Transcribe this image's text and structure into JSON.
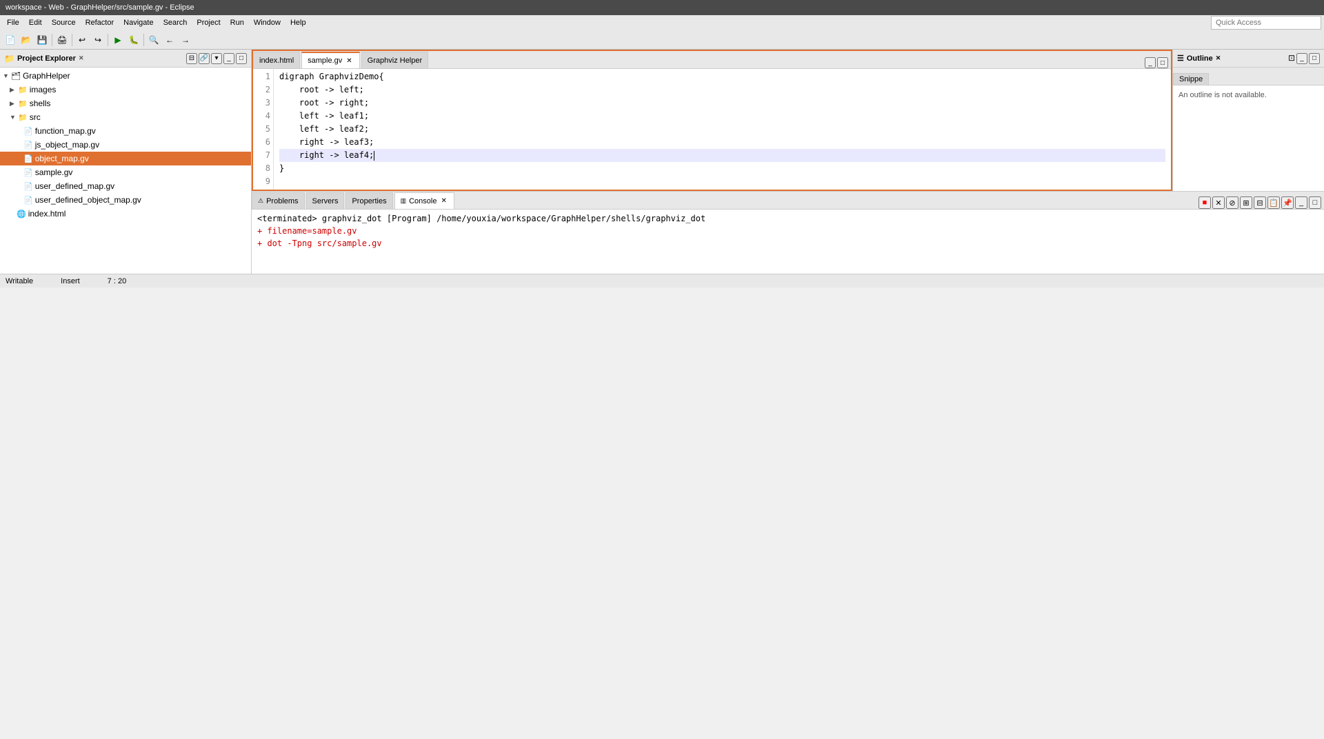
{
  "titleBar": {
    "text": "workspace - Web - GraphHelper/src/sample.gv - Eclipse"
  },
  "menuBar": {
    "items": [
      "File",
      "Edit",
      "Source",
      "Refactor",
      "Navigate",
      "Search",
      "Project",
      "Run",
      "Window",
      "Help"
    ]
  },
  "quickAccess": {
    "label": "Quick Access",
    "placeholder": "Quick Access"
  },
  "projectExplorer": {
    "title": "Project Explorer",
    "headerIcons": [
      "collapse-all-icon",
      "link-with-editor-icon",
      "view-menu-icon",
      "minimize-icon",
      "maximize-icon",
      "close-icon"
    ],
    "tree": [
      {
        "label": "GraphHelper",
        "indent": 0,
        "type": "project",
        "expanded": true
      },
      {
        "label": "images",
        "indent": 1,
        "type": "folder",
        "expanded": false
      },
      {
        "label": "shells",
        "indent": 1,
        "type": "folder",
        "expanded": false
      },
      {
        "label": "src",
        "indent": 1,
        "type": "folder",
        "expanded": true
      },
      {
        "label": "function_map.gv",
        "indent": 2,
        "type": "file"
      },
      {
        "label": "js_object_map.gv",
        "indent": 2,
        "type": "file"
      },
      {
        "label": "object_map.gv",
        "indent": 2,
        "type": "file",
        "selected": true
      },
      {
        "label": "sample.gv",
        "indent": 2,
        "type": "file"
      },
      {
        "label": "user_defined_map.gv",
        "indent": 2,
        "type": "file"
      },
      {
        "label": "user_defined_object_map.gv",
        "indent": 2,
        "type": "file"
      },
      {
        "label": "index.html",
        "indent": 1,
        "type": "html-file"
      }
    ]
  },
  "editor": {
    "tabs": [
      {
        "label": "index.html",
        "active": false,
        "closable": false
      },
      {
        "label": "sample.gv",
        "active": true,
        "closable": true
      },
      {
        "label": "Graphviz Helper",
        "active": false,
        "closable": false
      }
    ],
    "lines": [
      {
        "num": 1,
        "text": "digraph GraphvizDemo{"
      },
      {
        "num": 2,
        "text": "    root -> left;"
      },
      {
        "num": 3,
        "text": "    root -> right;"
      },
      {
        "num": 4,
        "text": "    left -> leaf1;"
      },
      {
        "num": 5,
        "text": "    left -> leaf2;"
      },
      {
        "num": 6,
        "text": "    right -> leaf3;"
      },
      {
        "num": 7,
        "text": "    right -> leaf4;",
        "highlighted": true,
        "cursor": true,
        "cursorCol": 20
      },
      {
        "num": 8,
        "text": "}"
      },
      {
        "num": 9,
        "text": ""
      }
    ]
  },
  "outline": {
    "title": "Outline",
    "message": "An outline is not available."
  },
  "bottomPanel": {
    "tabs": [
      {
        "label": "Problems",
        "active": false
      },
      {
        "label": "Servers",
        "active": false
      },
      {
        "label": "Properties",
        "active": false
      },
      {
        "label": "Console",
        "active": true,
        "closable": true
      }
    ],
    "console": {
      "lines": [
        {
          "text": "<terminated> graphviz_dot [Program] /home/youxia/workspace/GraphHelper/shells/graphviz_dot",
          "color": "black"
        },
        {
          "text": "+ filename=sample.gv",
          "color": "red"
        },
        {
          "text": "+ dot -Tpng src/sample.gv",
          "color": "red"
        }
      ]
    }
  },
  "statusBar": {
    "writable": "Writable",
    "mode": "Insert",
    "position": "7 : 20"
  }
}
